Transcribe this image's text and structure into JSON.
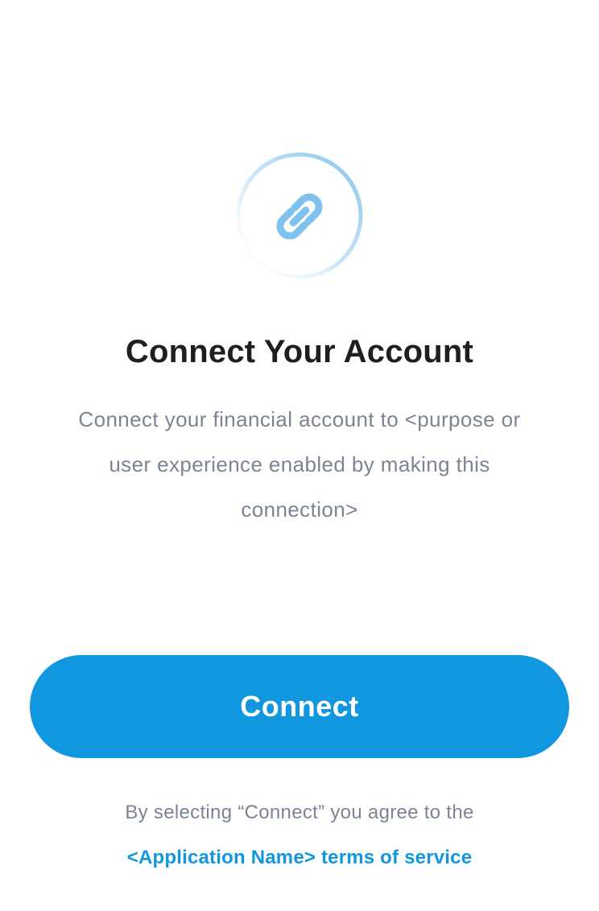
{
  "icon": {
    "name": "link-icon",
    "color": "#7fc2ee",
    "ring_color": "#7fc2ee"
  },
  "title": "Connect Your Account",
  "description": "Connect your financial account to <purpose or user experience enabled by making this connection>",
  "button": {
    "label": "Connect",
    "color": "#1196e0"
  },
  "agreement": {
    "text": "By selecting “Connect” you agree to the",
    "link_text": "<Application Name> terms of service"
  }
}
